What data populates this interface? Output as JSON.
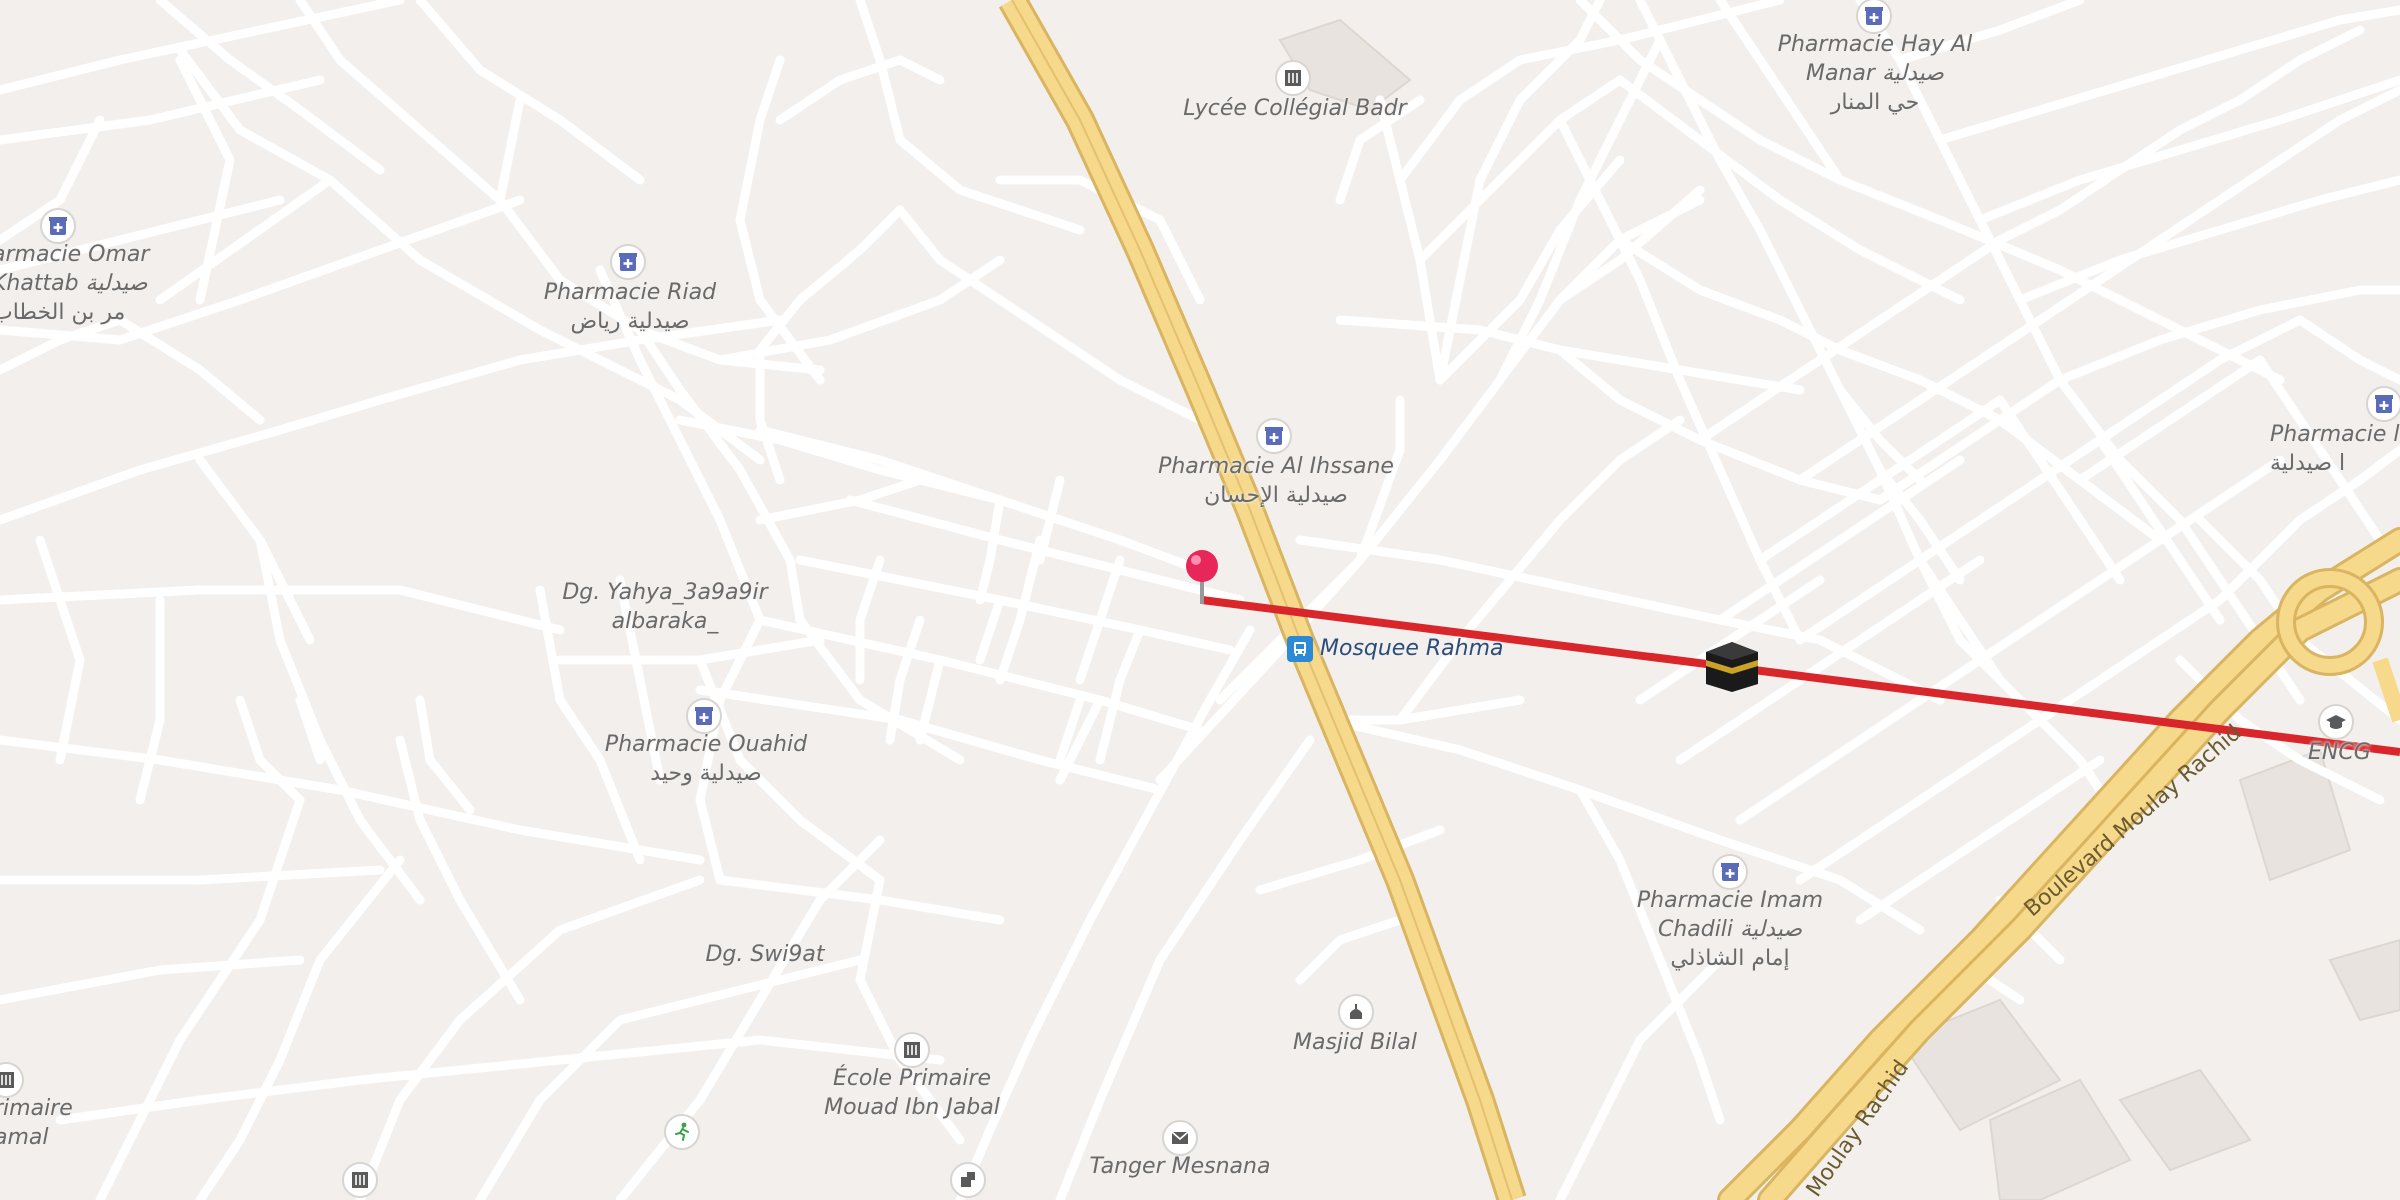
{
  "map": {
    "pois": [
      {
        "id": "pharmacie-omar",
        "icon": "pharmacy-icon",
        "name": "armacie Omar",
        "name2": "Khattab صيدلية",
        "arabic": "مر بن الخطاب"
      },
      {
        "id": "pharmacie-riad",
        "icon": "pharmacy-icon",
        "name": "Pharmacie Riad",
        "arabic": "صيدلية رياض"
      },
      {
        "id": "lycee-badr",
        "icon": "school-icon",
        "name": "Lycée Collégial Badr"
      },
      {
        "id": "pharmacie-hay-al-manar",
        "icon": "pharmacy-icon",
        "name": "Pharmacie Hay Al",
        "name2": "Manar صيدلية",
        "arabic": "حي المنار"
      },
      {
        "id": "pharmacie-al-ihssane",
        "icon": "pharmacy-icon",
        "name": "Pharmacie Al Ihssane",
        "arabic": "صيدلية الإحسان"
      },
      {
        "id": "pharmacie-right",
        "icon": "pharmacy-icon",
        "name": "Pharmacie l",
        "arabic": "صيدلية l"
      },
      {
        "id": "dg-yahya",
        "icon": "",
        "name": "Dg. Yahya_3a9a9ir",
        "name2": "albaraka_"
      },
      {
        "id": "mosquee-rahma",
        "icon": "bus-stop-icon",
        "name": "Mosquee Rahma"
      },
      {
        "id": "pharmacie-ouahid",
        "icon": "pharmacy-icon",
        "name": "Pharmacie Ouahid",
        "arabic": "صيدلية وحيد"
      },
      {
        "id": "encg",
        "icon": "university-icon",
        "name": "ENCG"
      },
      {
        "id": "pharmacie-imam-chadili",
        "icon": "pharmacy-icon",
        "name": "Pharmacie Imam",
        "name2": "Chadili صيدلية",
        "arabic": "إمام الشاذلي"
      },
      {
        "id": "dg-swi9at",
        "icon": "",
        "name": "Dg. Swi9at"
      },
      {
        "id": "ecole-mouad",
        "icon": "school-icon",
        "name": "École Primaire",
        "name2": "Mouad Ibn Jabal"
      },
      {
        "id": "masjid-bilal",
        "icon": "mosque-icon",
        "name": "Masjid Bilal"
      },
      {
        "id": "tanger-mesnana",
        "icon": "post-office-icon",
        "name": "Tanger Mesnana"
      },
      {
        "id": "ecole-left",
        "icon": "school-icon",
        "name": "rimaire",
        "name2": "amal"
      }
    ],
    "roads": [
      {
        "id": "boulevard-moulay-rachid",
        "label": "Boulevard Moulay Rachid"
      },
      {
        "id": "moulay-rachid-lower",
        "label": "Moulay Rachid"
      }
    ],
    "icons": {
      "location_pin": "location-pin-icon",
      "qibla_marker": "kaaba-icon",
      "sports": "sports-icon",
      "other_left": "school-icon",
      "other_bottom": "building-icon"
    },
    "colors": {
      "background": "#f2efec",
      "road": "#ffffff",
      "highway_fill": "#f6d98a",
      "highway_edge": "#d9b562",
      "qibla_line": "#d9262a",
      "pin": "#e8265a",
      "poi_icon": "#5a6bb8",
      "bus": "#2a8ad6",
      "text": "#6a6a6a",
      "text_bus": "#2a4d7a"
    }
  }
}
